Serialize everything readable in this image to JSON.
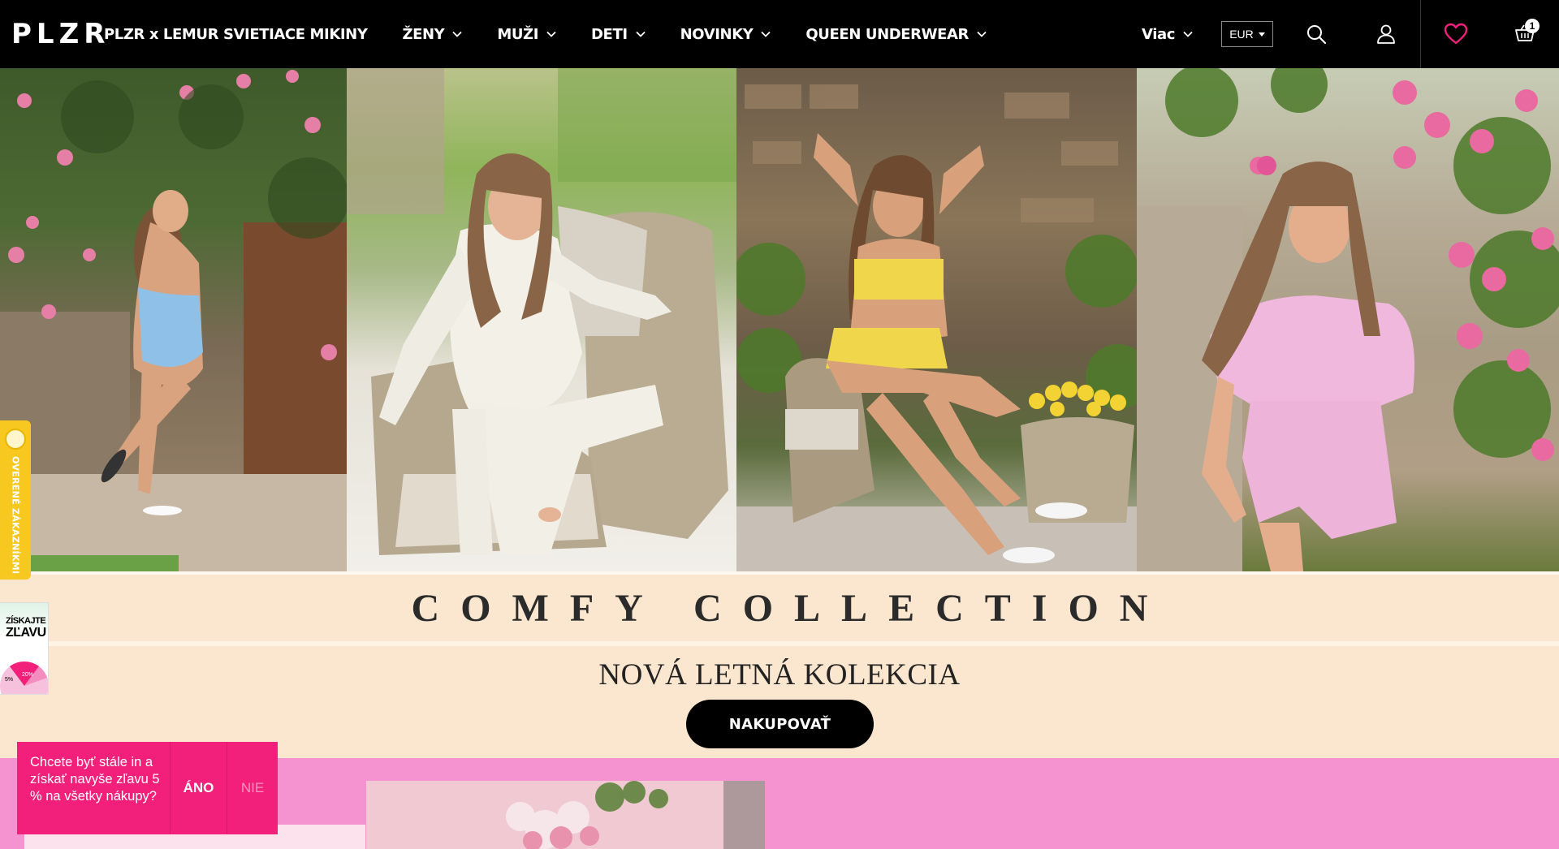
{
  "header": {
    "logo": "PLZR",
    "nav": [
      {
        "label": "PLZR x LEMUR SVIETIACE MIKINY",
        "has_dropdown": false
      },
      {
        "label": "ŽENY",
        "has_dropdown": true
      },
      {
        "label": "MUŽI",
        "has_dropdown": true
      },
      {
        "label": "DETI",
        "has_dropdown": true
      },
      {
        "label": "NOVINKY",
        "has_dropdown": true
      },
      {
        "label": "QUEEN UNDERWEAR",
        "has_dropdown": true
      }
    ],
    "more_label": "Viac",
    "currency": "EUR",
    "cart_count": "1",
    "icons": [
      "search-icon",
      "user-icon",
      "heart-icon",
      "cart-icon"
    ],
    "colors": {
      "background": "#000000",
      "text": "#ffffff",
      "heart": "#f2207a"
    }
  },
  "hero": {
    "panels": [
      "floral-swimsuit-photo",
      "white-loungewear-photo",
      "yellow-bikini-photo",
      "pink-pajama-photo"
    ]
  },
  "collection": {
    "title": "COMFY COLLECTION",
    "subtitle": "NOVÁ LETNÁ KOLEKCIA",
    "cta": "NAKUPOVAŤ",
    "background": "#fbe7cf"
  },
  "side_widgets": {
    "verified": "OVERENÉ ZÁKAZNÍKMI",
    "discount_line1": "ZÍSKAJTE",
    "discount_line2": "ZĽAVU",
    "wheel_labels": [
      "5%",
      "20%"
    ]
  },
  "notification": {
    "message": "Chcete byť stále in a získať navyše zľavu 5 % na všetky nákupy?",
    "yes": "ÁNO",
    "no": "NIE",
    "color": "#f2207a"
  },
  "lower_section": {
    "background": "#f593d0"
  }
}
